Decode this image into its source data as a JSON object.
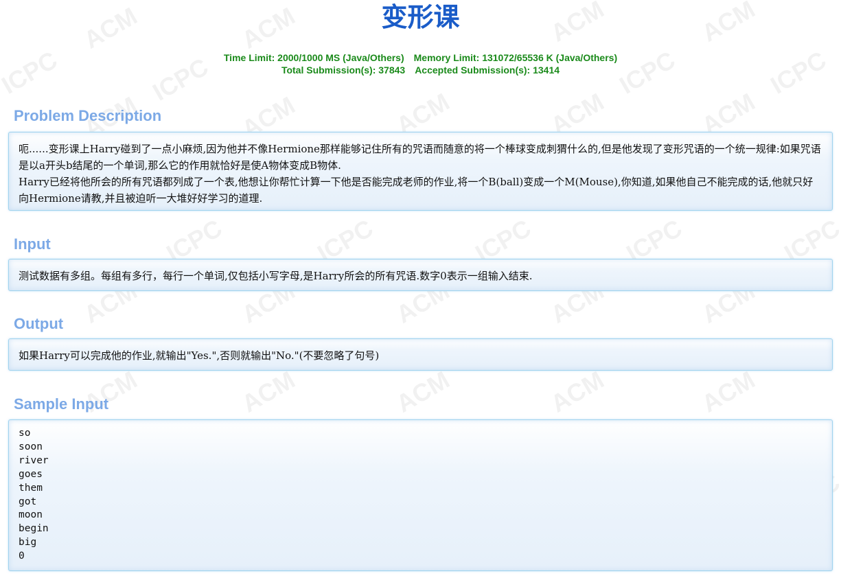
{
  "problem": {
    "title": "变形课",
    "limits": {
      "time_limit": "Time Limit: 2000/1000 MS (Java/Others)",
      "memory_limit": "Memory Limit: 131072/65536 K (Java/Others)",
      "total_submissions": "Total Submission(s): 37843",
      "accepted_submissions": "Accepted Submission(s): 13414"
    },
    "watermark": {
      "acm": "ACM",
      "icpc": "ICPC"
    },
    "description": {
      "heading": "Problem Description",
      "line1": "呃......变形课上Harry碰到了一点小麻烦,因为他并不像Hermione那样能够记住所有的咒语而随意的将一个棒球变成刺猬什么的,但是他发现了变形咒语的一个统一规律:如果咒语是以a开头b结尾的一个单词,那么它的作用就恰好是使A物体变成B物体.",
      "line2": "Harry已经将他所会的所有咒语都列成了一个表,他想让你帮忙计算一下他是否能完成老师的作业,将一个B(ball)变成一个M(Mouse),你知道,如果他自己不能完成的话,他就只好向Hermione请教,并且被迫听一大堆好好学习的道理."
    },
    "input": {
      "heading": "Input",
      "text": "测试数据有多组。每组有多行，每行一个单词,仅包括小写字母,是Harry所会的所有咒语.数字0表示一组输入结束."
    },
    "output": {
      "heading": "Output",
      "text": "如果Harry可以完成他的作业,就输出\"Yes.\",否则就输出\"No.\"(不要忽略了句号)"
    },
    "sample_input": {
      "heading": "Sample Input",
      "text": "so\nsoon\nriver\ngoes\nthem\ngot\nmoon\nbegin\nbig\n0"
    }
  }
}
